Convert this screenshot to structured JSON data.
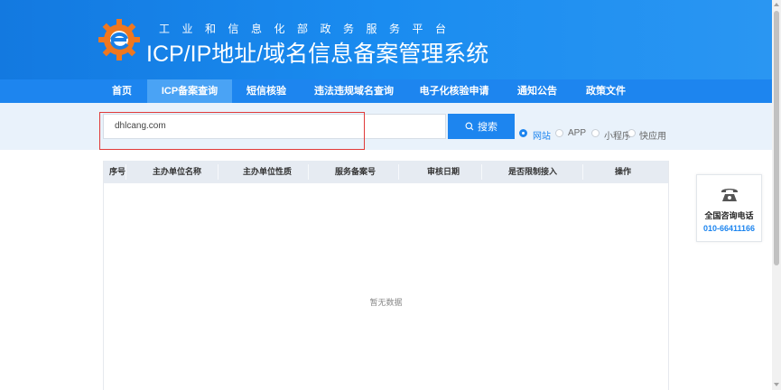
{
  "header": {
    "subtitle": "工业和信息化部政务服务平台",
    "title": "ICP/IP地址/域名信息备案管理系统"
  },
  "nav": {
    "items": [
      {
        "label": "首页",
        "active": false
      },
      {
        "label": "ICP备案查询",
        "active": true
      },
      {
        "label": "短信核验",
        "active": false
      },
      {
        "label": "违法违规域名查询",
        "active": false
      },
      {
        "label": "电子化核验申请",
        "active": false
      },
      {
        "label": "通知公告",
        "active": false
      },
      {
        "label": "政策文件",
        "active": false
      }
    ]
  },
  "search": {
    "value": "dhlcang.com",
    "button_label": "搜索",
    "options": [
      {
        "label": "网站",
        "checked": true
      },
      {
        "label": "APP",
        "checked": false
      },
      {
        "label": "小程序",
        "checked": false
      },
      {
        "label": "快应用",
        "checked": false
      }
    ]
  },
  "table": {
    "columns": [
      "序号",
      "主办单位名称",
      "主办单位性质",
      "服务备案号",
      "审核日期",
      "是否限制接入",
      "操作"
    ],
    "empty_text": "暂无数据"
  },
  "side": {
    "label": "全国咨询电话",
    "phone": "010-66411166"
  },
  "colors": {
    "primary": "#1d85ef",
    "highlight": "#e03a3a"
  }
}
